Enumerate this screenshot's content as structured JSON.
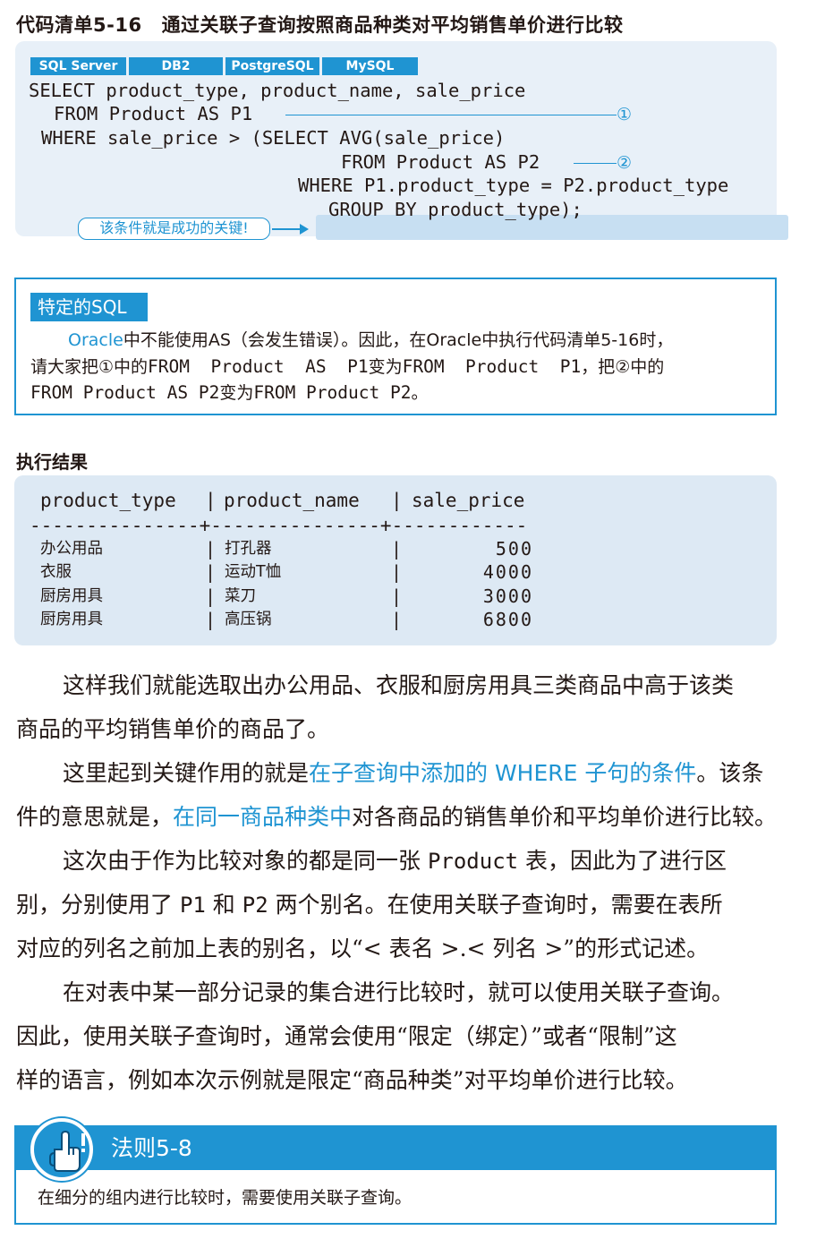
{
  "listing": {
    "number": "代码清单5-16",
    "title": "通过关联子查询按照商品种类对平均销售单价进行比较"
  },
  "db_tags": [
    "SQL Server",
    "DB2",
    "PostgreSQL",
    "MySQL"
  ],
  "code": {
    "line1": "SELECT product_type, product_name, sale_price",
    "line2": "FROM Product AS P1",
    "line3": "WHERE sale_price > (SELECT AVG(sale_price)",
    "line4": "FROM Product AS P2",
    "line5": "WHERE P1.product_type = P2.product_type",
    "line6": "GROUP BY product_type);",
    "marker1": "①",
    "marker2": "②",
    "key_note": "该条件就是成功的关键!"
  },
  "note": {
    "tag": "特定的SQL",
    "l1_a": "Oracle",
    "l1_b": "中不能使用AS（会发生错误）。因此，在Oracle中执行代码清单5-16时，",
    "l2_a": "请大家把①中的",
    "l2_b": "FROM  Product  AS  P1",
    "l2_c": "变为",
    "l2_d": "FROM  Product  P1",
    "l2_e": "，把②中的",
    "l3_a": "FROM Product AS P2",
    "l3_b": "变为",
    "l3_c": "FROM Product P2",
    "l3_d": "。"
  },
  "result": {
    "heading": "执行结果",
    "columns": [
      "product_type",
      "product_name",
      "sale_price"
    ],
    "separator": "---------------+---------------+------------",
    "rows": [
      {
        "product_type": "办公用品",
        "product_name": "打孔器",
        "sale_price": "500"
      },
      {
        "product_type": "衣服",
        "product_name": "运动T恤",
        "sale_price": "4000"
      },
      {
        "product_type": "厨房用具",
        "product_name": "菜刀",
        "sale_price": "3000"
      },
      {
        "product_type": "厨房用具",
        "product_name": "高压锅",
        "sale_price": "6800"
      }
    ]
  },
  "body": {
    "p1_l1": "这样我们就能选取出办公用品、衣服和厨房用具三类商品中高于该类",
    "p1_l2": "商品的平均销售单价的商品了。",
    "p2_l1_a": "这里起到关键作用的就是",
    "p2_l1_b": "在子查询中添加的 WHERE 子句的条件",
    "p2_l1_c": "。该条",
    "p2_l2_a": "件的意思就是，",
    "p2_l2_b": "在同一商品种类中",
    "p2_l2_c": "对各商品的销售单价和平均单价进行比较。",
    "p3_l1_a": "这次由于作为比较对象的都是同一张 ",
    "p3_l1_b": "Product",
    "p3_l1_c": " 表，因此为了进行区",
    "p3_l2_a": "别，分别使用了 ",
    "p3_l2_b": "P1",
    "p3_l2_c": " 和 ",
    "p3_l2_d": "P2",
    "p3_l2_e": " 两个别名。在使用关联子查询时，需要在表所",
    "p3_l3": "对应的列名之前加上表的别名，以“< 表名 >.< 列名 >”的形式记述。",
    "p4_l1": "在对表中某一部分记录的集合进行比较时，就可以使用关联子查询。",
    "p4_l2": "因此，使用关联子查询时，通常会使用“限定（绑定）”或者“限制”这",
    "p4_l3": "样的语言，例如本次示例就是限定“商品种类”对平均单价进行比较。"
  },
  "rule": {
    "title": "法则5-8",
    "text": "在细分的组内进行比较时，需要使用关联子查询。"
  },
  "colors": {
    "accent": "#1f94d2",
    "code_bg": "#e8f0f8",
    "result_bg": "#dde9f4",
    "highlight": "#c7dff2"
  }
}
